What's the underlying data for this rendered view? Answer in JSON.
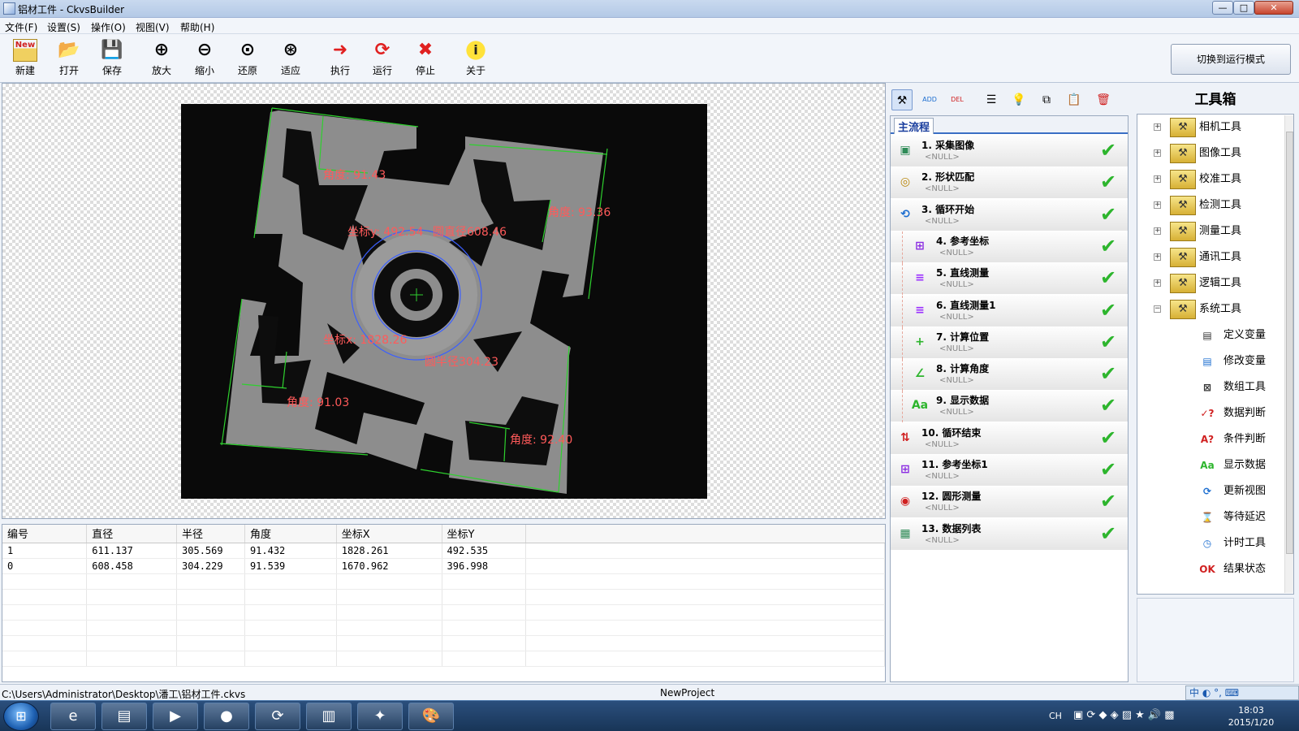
{
  "window": {
    "title": "铝材工件 - CkvsBuilder",
    "min_glyph": "—",
    "max_glyph": "□",
    "close_glyph": "✕"
  },
  "menu": [
    "文件(F)",
    "设置(S)",
    "操作(O)",
    "视图(V)",
    "帮助(H)"
  ],
  "toolbar": {
    "new": "新建",
    "open": "打开",
    "save": "保存",
    "zoom_in": "放大",
    "zoom_out": "缩小",
    "restore": "还原",
    "fit": "适应",
    "execute": "执行",
    "run": "运行",
    "stop": "停止",
    "about": "关于",
    "new_badge": "New",
    "switch_mode": "切换到运行模式"
  },
  "overlay": {
    "angle_tl": "角度: 91.43",
    "angle_tr": "角度: 93.36",
    "angle_bl": "角度: 91.03",
    "angle_br": "角度: 92.40",
    "coord_y": "坐标y: 492.54",
    "circle_d": "圆直径608.46",
    "coord_x": "坐标x: 1828.26",
    "circle_r": "圆半径304.23"
  },
  "table": {
    "headers": [
      "编号",
      "直径",
      "半径",
      "角度",
      "坐标X",
      "坐标Y"
    ],
    "rows": [
      [
        "1",
        "611.137",
        "305.569",
        "91.432",
        "1828.261",
        "492.535"
      ],
      [
        "0",
        "608.458",
        "304.229",
        "91.539",
        "1670.962",
        "396.998"
      ]
    ]
  },
  "flow": {
    "tab": "主流程",
    "toolbar_icons": [
      "tool-icon",
      "add-icon",
      "delete-icon",
      "properties-icon",
      "bulb-icon",
      "copy-icon",
      "paste-icon",
      "trash-icon"
    ],
    "toolbar_glyphs": [
      "⚒",
      "ADD",
      "DEL",
      "☰",
      "💡",
      "⧉",
      "📋",
      "🗑"
    ],
    "steps": [
      {
        "name": "1. 采集图像",
        "sub": "<NULL>",
        "glyph": "▣",
        "color": "#2e8b57",
        "child": false
      },
      {
        "name": "2. 形状匹配",
        "sub": "<NULL>",
        "glyph": "◎",
        "color": "#b8860b",
        "child": false
      },
      {
        "name": "3. 循环开始",
        "sub": "<NULL>",
        "glyph": "⟲",
        "color": "#1e6fd0",
        "child": false
      },
      {
        "name": "4. 参考坐标",
        "sub": "<NULL>",
        "glyph": "⊞",
        "color": "#8a2be2",
        "child": true
      },
      {
        "name": "5. 直线测量",
        "sub": "<NULL>",
        "glyph": "≡",
        "color": "#9b30ff",
        "child": true
      },
      {
        "name": "6. 直线测量1",
        "sub": "<NULL>",
        "glyph": "≡",
        "color": "#9b30ff",
        "child": true
      },
      {
        "name": "7. 计算位置",
        "sub": "<NULL>",
        "glyph": "+",
        "color": "#2db52d",
        "child": true
      },
      {
        "name": "8. 计算角度",
        "sub": "<NULL>",
        "glyph": "∠",
        "color": "#2db52d",
        "child": true
      },
      {
        "name": "9. 显示数据",
        "sub": "<NULL>",
        "glyph": "Aa",
        "color": "#2db52d",
        "child": true
      },
      {
        "name": "10. 循环结束",
        "sub": "<NULL>",
        "glyph": "⇅",
        "color": "#d02020",
        "child": false
      },
      {
        "name": "11. 参考坐标1",
        "sub": "<NULL>",
        "glyph": "⊞",
        "color": "#8a2be2",
        "child": false
      },
      {
        "name": "12. 圆形测量",
        "sub": "<NULL>",
        "glyph": "◉",
        "color": "#d02020",
        "child": false
      },
      {
        "name": "13. 数据列表",
        "sub": "<NULL>",
        "glyph": "▦",
        "color": "#2e8b57",
        "child": false
      }
    ],
    "check_glyph": "✔"
  },
  "toolbox": {
    "title": "工具箱",
    "categories": [
      "相机工具",
      "图像工具",
      "校准工具",
      "检测工具",
      "测量工具",
      "通讯工具",
      "逻辑工具",
      "系统工具"
    ],
    "folder_glyph": "⚒",
    "expand_glyph": "+",
    "collapse_glyph": "−",
    "system_items": [
      {
        "label": "定义变量",
        "glyph": "▤",
        "color": "#333"
      },
      {
        "label": "修改变量",
        "glyph": "▤",
        "color": "#1e6fd0"
      },
      {
        "label": "数组工具",
        "glyph": "⊠",
        "color": "#333"
      },
      {
        "label": "数据判断",
        "glyph": "✓?",
        "color": "#d02020"
      },
      {
        "label": "条件判断",
        "glyph": "A?",
        "color": "#d02020"
      },
      {
        "label": "显示数据",
        "glyph": "Aa",
        "color": "#2db52d"
      },
      {
        "label": "更新视图",
        "glyph": "⟳",
        "color": "#1e6fd0"
      },
      {
        "label": "等待延迟",
        "glyph": "⌛",
        "color": "#1e6fd0"
      },
      {
        "label": "计时工具",
        "glyph": "◷",
        "color": "#1e6fd0"
      },
      {
        "label": "结果状态",
        "glyph": "OK",
        "color": "#d02020"
      }
    ]
  },
  "status": {
    "path": "C:\\Users\\Administrator\\Desktop\\潘工\\铝材工件.ckvs",
    "project": "NewProject",
    "ime": "中 ◐ °, ⌨"
  },
  "taskbar": {
    "start": "⊞",
    "apps": [
      "e",
      "▤",
      "▶",
      "●",
      "⟳",
      "▥",
      "✦",
      "🎨"
    ],
    "app_names": [
      "ie-icon",
      "explorer-icon",
      "media-icon",
      "chrome-icon",
      "360-icon",
      "book-icon",
      "vision-icon",
      "paint-icon"
    ],
    "tray_lang": "CH",
    "time": "18:03",
    "date": "2015/1/20"
  }
}
